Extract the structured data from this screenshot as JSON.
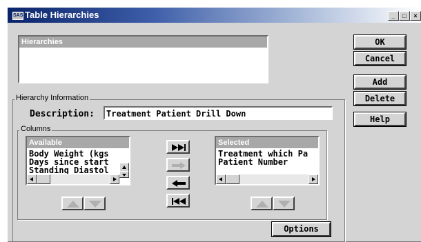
{
  "window": {
    "title": "Table Hierarchies",
    "title_icon_text": "SAS",
    "minimize_label": "_",
    "maximize_label": "□",
    "close_label": "×"
  },
  "hierarchies": {
    "header": "Hierarchies",
    "items": []
  },
  "buttons": {
    "ok": "OK",
    "cancel": "Cancel",
    "add": "Add",
    "delete": "Delete",
    "help": "Help",
    "options": "Options"
  },
  "hierarchy_info": {
    "group_label": "Hierarchy Information",
    "description_label": "Description:",
    "description_value": "Treatment Patient Drill Down",
    "columns_label": "Columns"
  },
  "available": {
    "header": "Available",
    "items": [
      "Body Weight (kgs",
      "Days since start",
      "Standing Diastol"
    ]
  },
  "selected": {
    "header": "Selected",
    "items": [
      "Treatment which Pa",
      "Patient Number"
    ]
  },
  "icons": {
    "move_all_right": "double-right-arrow-icon",
    "move_right": "right-arrow-icon",
    "move_left": "left-arrow-icon",
    "move_all_left": "double-left-arrow-icon",
    "move_up": "up-arrow-icon",
    "move_down": "down-arrow-icon"
  },
  "colors": {
    "titlebar_start": "#0a246a",
    "window_bg": "#d4d4d4",
    "list_header_bg": "#a8a8a8"
  }
}
